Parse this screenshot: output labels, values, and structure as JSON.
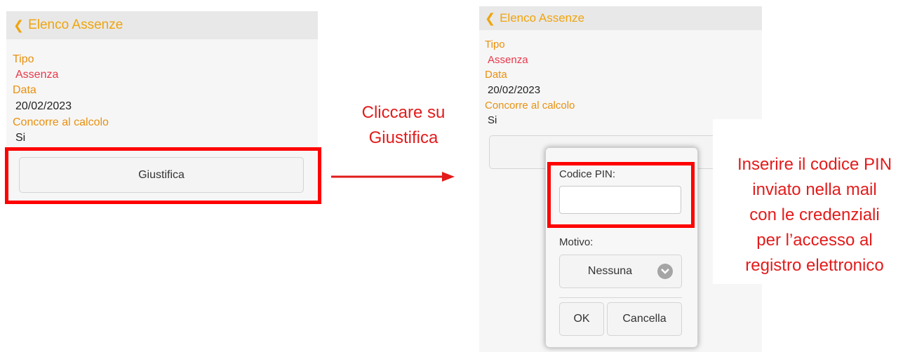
{
  "left_screen": {
    "back_label": "Elenco Assenze",
    "fields": [
      {
        "label": "Tipo",
        "value": "Assenza"
      },
      {
        "label": "Data",
        "value": "20/02/2023"
      },
      {
        "label": "Concorre al calcolo",
        "value": "Si"
      }
    ],
    "justify_button": "Giustifica"
  },
  "instruction_1": {
    "line1": "Cliccare su",
    "line2": "Giustifica"
  },
  "right_screen": {
    "back_label": "Elenco Assenze",
    "fields": [
      {
        "label": "Tipo",
        "value": "Assenza"
      },
      {
        "label": "Data",
        "value": "20/02/2023"
      },
      {
        "label": "Concorre al calcolo",
        "value": "Si"
      }
    ]
  },
  "dialog": {
    "pin_label": "Codice PIN:",
    "pin_value": "",
    "reason_label": "Motivo:",
    "reason_selected": "Nessuna",
    "ok_label": "OK",
    "cancel_label": "Cancella"
  },
  "instruction_2": {
    "lines": [
      "Inserire il codice PIN",
      "inviato nella mail",
      "con le credenziali",
      "per l’accesso al",
      "registro elettronico"
    ]
  },
  "colors": {
    "accent": "#f0a40c",
    "label": "#e8900f",
    "value_red": "#e8374a",
    "annotation_red": "#ff0000"
  },
  "icons": {
    "back": "chevron-left-icon",
    "select": "chevron-down-circle-icon",
    "arrow": "arrow-right-icon"
  }
}
